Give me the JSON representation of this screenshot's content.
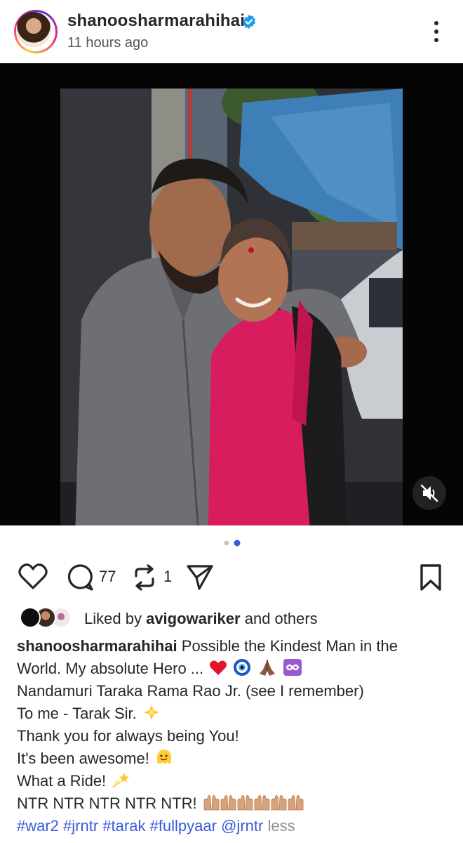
{
  "post": {
    "username": "shanoosharmarahihai",
    "timestamp": "11 hours ago"
  },
  "media": {
    "slide_count": 2,
    "active_slide": 2
  },
  "actions": {
    "comment_count": "77",
    "repost_count": "1"
  },
  "likes": {
    "prefix": "Liked by",
    "user": "avigowariker",
    "suffix": "and others"
  },
  "caption": {
    "username": "shanoosharmarahihai",
    "line1_text": "Possible the Kindest Man in the",
    "line2_text": "World. My absolute Hero ...",
    "line3": "Nandamuri Taraka Rama Rao Jr. (see I remember)",
    "line4_text": "To me - Tarak Sir.",
    "line5": "Thank you for always being You!",
    "line6_text": "It's been awesome!",
    "line7_text": "What a Ride!",
    "line8_text": "NTR NTR NTR NTR NTR!",
    "hashtags": [
      "#war2",
      "#jrntr",
      "#tarak",
      "#fullpyaar",
      "@jrntr"
    ],
    "less_label": "less"
  },
  "colors": {
    "accent_blue": "#3897f0",
    "link_blue": "#3a5bd9",
    "active_dot": "#3a5bd9"
  }
}
